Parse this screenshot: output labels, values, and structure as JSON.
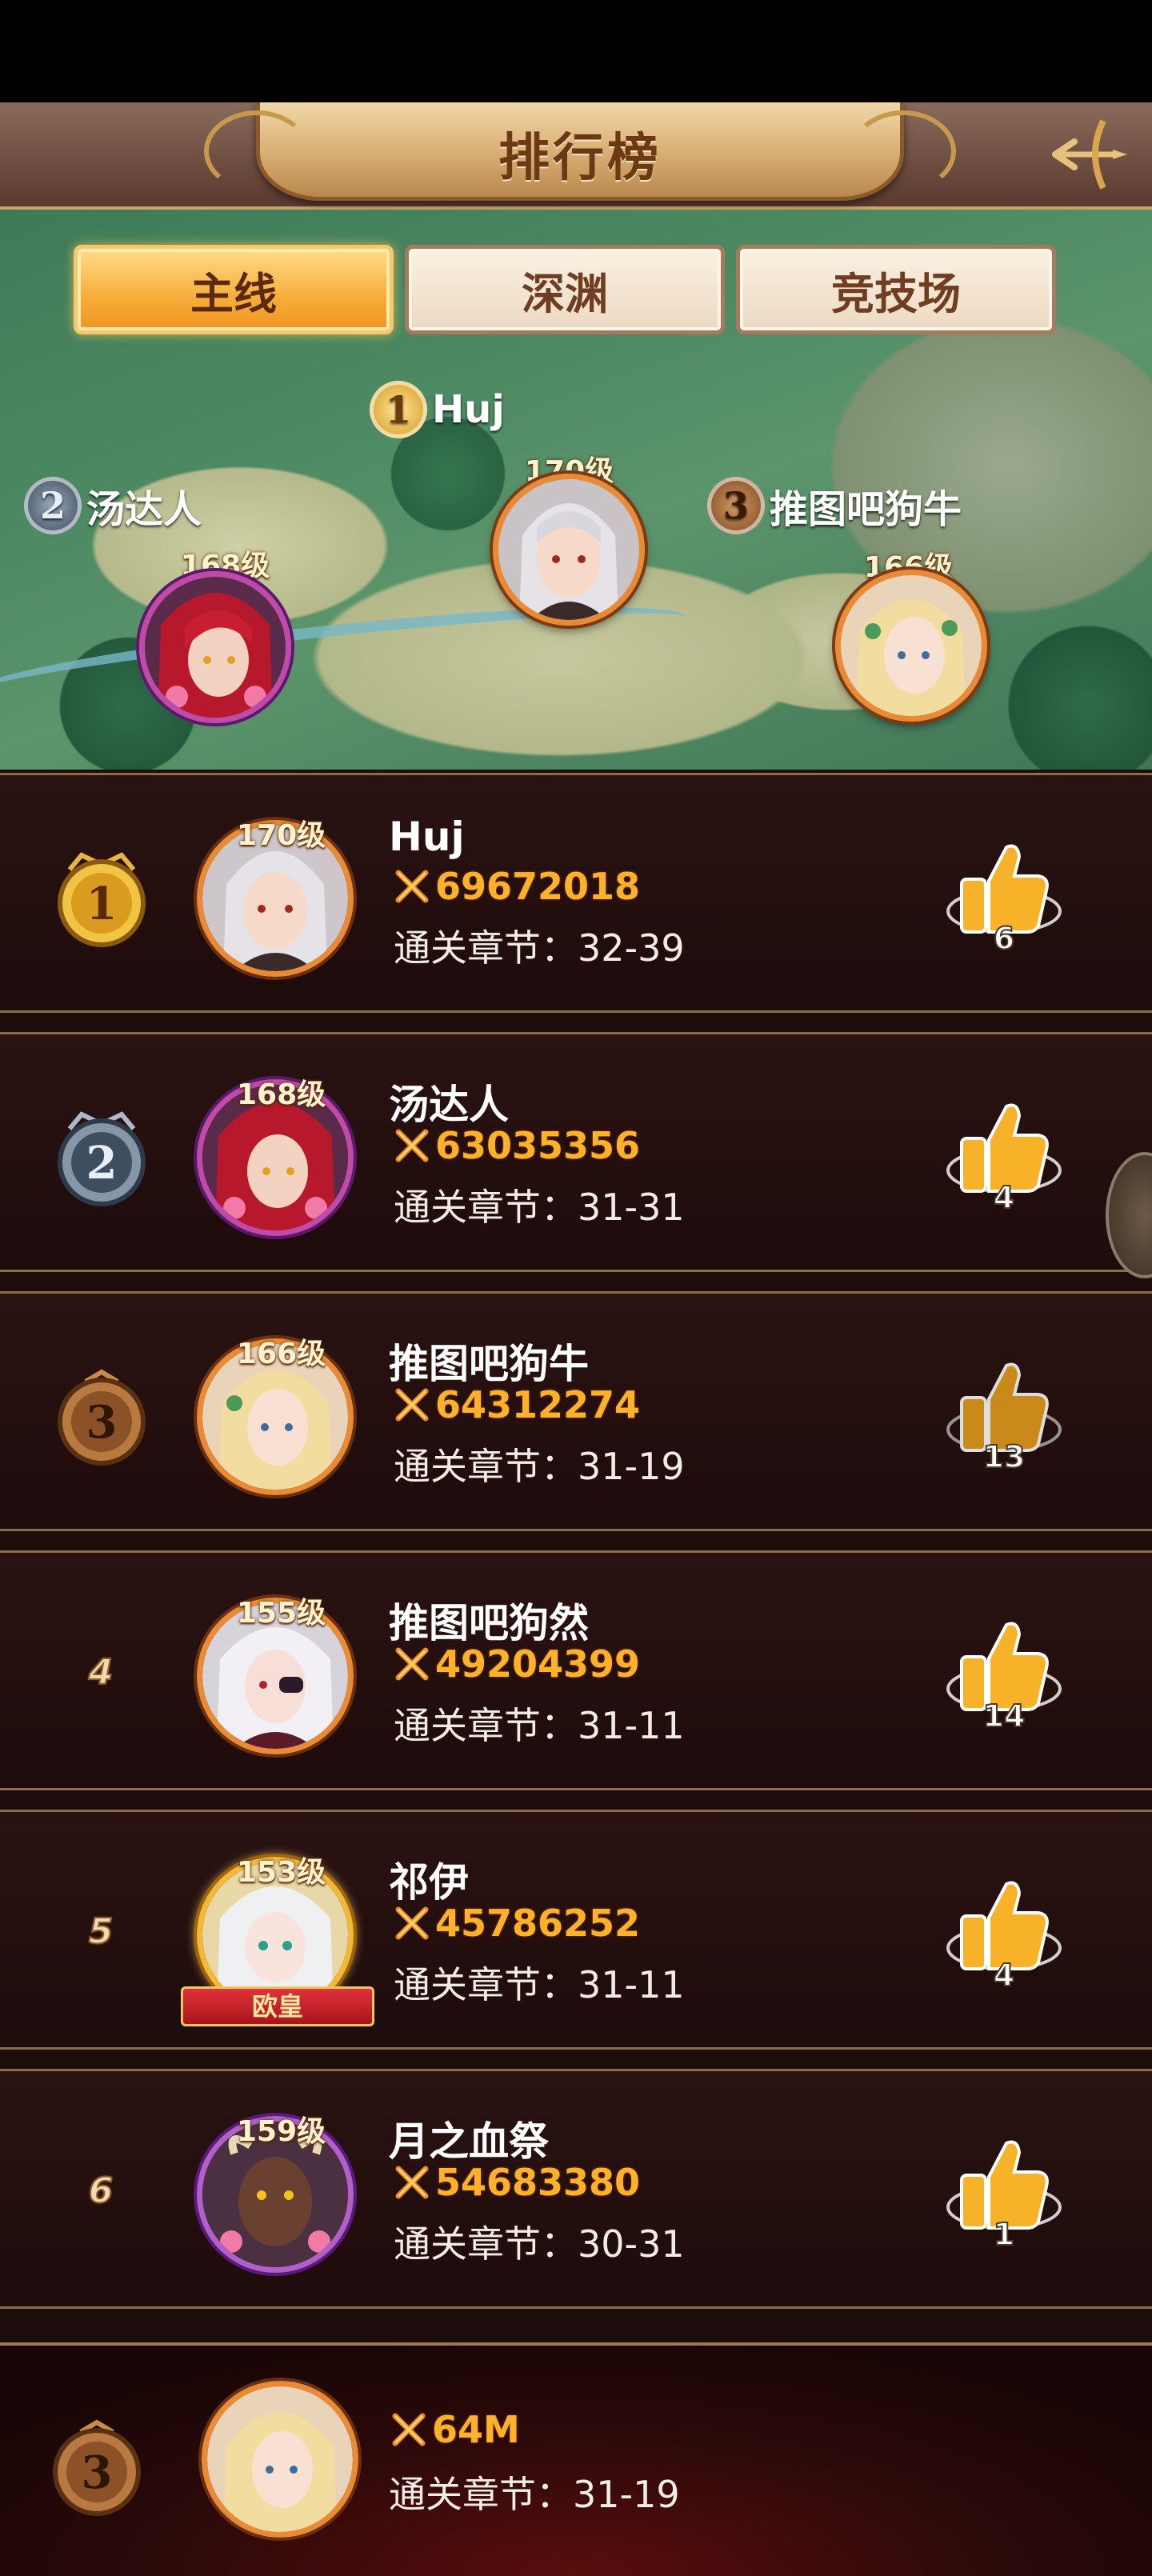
{
  "header": {
    "title": "排行榜",
    "back_icon": "bow-arrow-icon"
  },
  "tabs": [
    {
      "label": "主线",
      "active": true
    },
    {
      "label": "深渊",
      "active": false
    },
    {
      "label": "竞技场",
      "active": false
    }
  ],
  "podium": {
    "first": {
      "rank": "1",
      "name": "Huj",
      "level": "170级"
    },
    "second": {
      "rank": "2",
      "name": "汤达人",
      "level": "168级"
    },
    "third": {
      "rank": "3",
      "name": "推图吧狗牛",
      "level": "166级"
    }
  },
  "rows": [
    {
      "rank": "1",
      "level": "170级",
      "name": "Huj",
      "power": "69672018",
      "chapter": "通关章节：32-39",
      "likes": "6"
    },
    {
      "rank": "2",
      "level": "168级",
      "name": "汤达人",
      "power": "63035356",
      "chapter": "通关章节：31-31",
      "likes": "4"
    },
    {
      "rank": "3",
      "level": "166级",
      "name": "推图吧狗牛",
      "power": "64312274",
      "chapter": "通关章节：31-19",
      "likes": "13"
    },
    {
      "rank": "4",
      "level": "155级",
      "name": "推图吧狗然",
      "power": "49204399",
      "chapter": "通关章节：31-11",
      "likes": "14"
    },
    {
      "rank": "5",
      "level": "153级",
      "name": "祁伊",
      "power": "45786252",
      "chapter": "通关章节：31-11",
      "likes": "4",
      "vip_ribbon": "欧皇"
    },
    {
      "rank": "6",
      "level": "159级",
      "name": "月之血祭",
      "power": "54683380",
      "chapter": "通关章节：30-31",
      "likes": "1"
    }
  ],
  "self": {
    "rank": "3",
    "power": "64M",
    "chapter": "通关章节：31-19"
  },
  "colors": {
    "accent_orange": "#ffb12a",
    "tab_active": "#f7ad3a",
    "row_bg": "#1e0b0b"
  }
}
